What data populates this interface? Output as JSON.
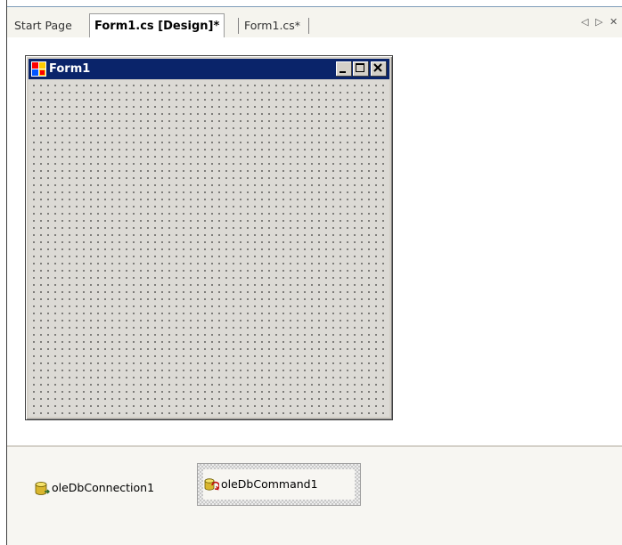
{
  "tabs": [
    {
      "label": "Start Page"
    },
    {
      "label": "Form1.cs [Design]*",
      "active": true
    },
    {
      "label": "Form1.cs*"
    }
  ],
  "tab_nav": {
    "prev_glyph": "◁",
    "next_glyph": "▷",
    "close_glyph": "✕"
  },
  "form": {
    "title": "Form1",
    "caption_buttons": [
      "minimize",
      "maximize",
      "close"
    ]
  },
  "tray": {
    "components": [
      {
        "label": "oleDbConnection1",
        "icon": "db-connection-icon"
      },
      {
        "label": "oleDbCommand1",
        "icon": "db-command-icon",
        "selected": true
      }
    ]
  },
  "colors": {
    "titlebar": "#0a246a",
    "form_surface": "#d4d0c8",
    "tab_strip": "#f5f4ee"
  }
}
